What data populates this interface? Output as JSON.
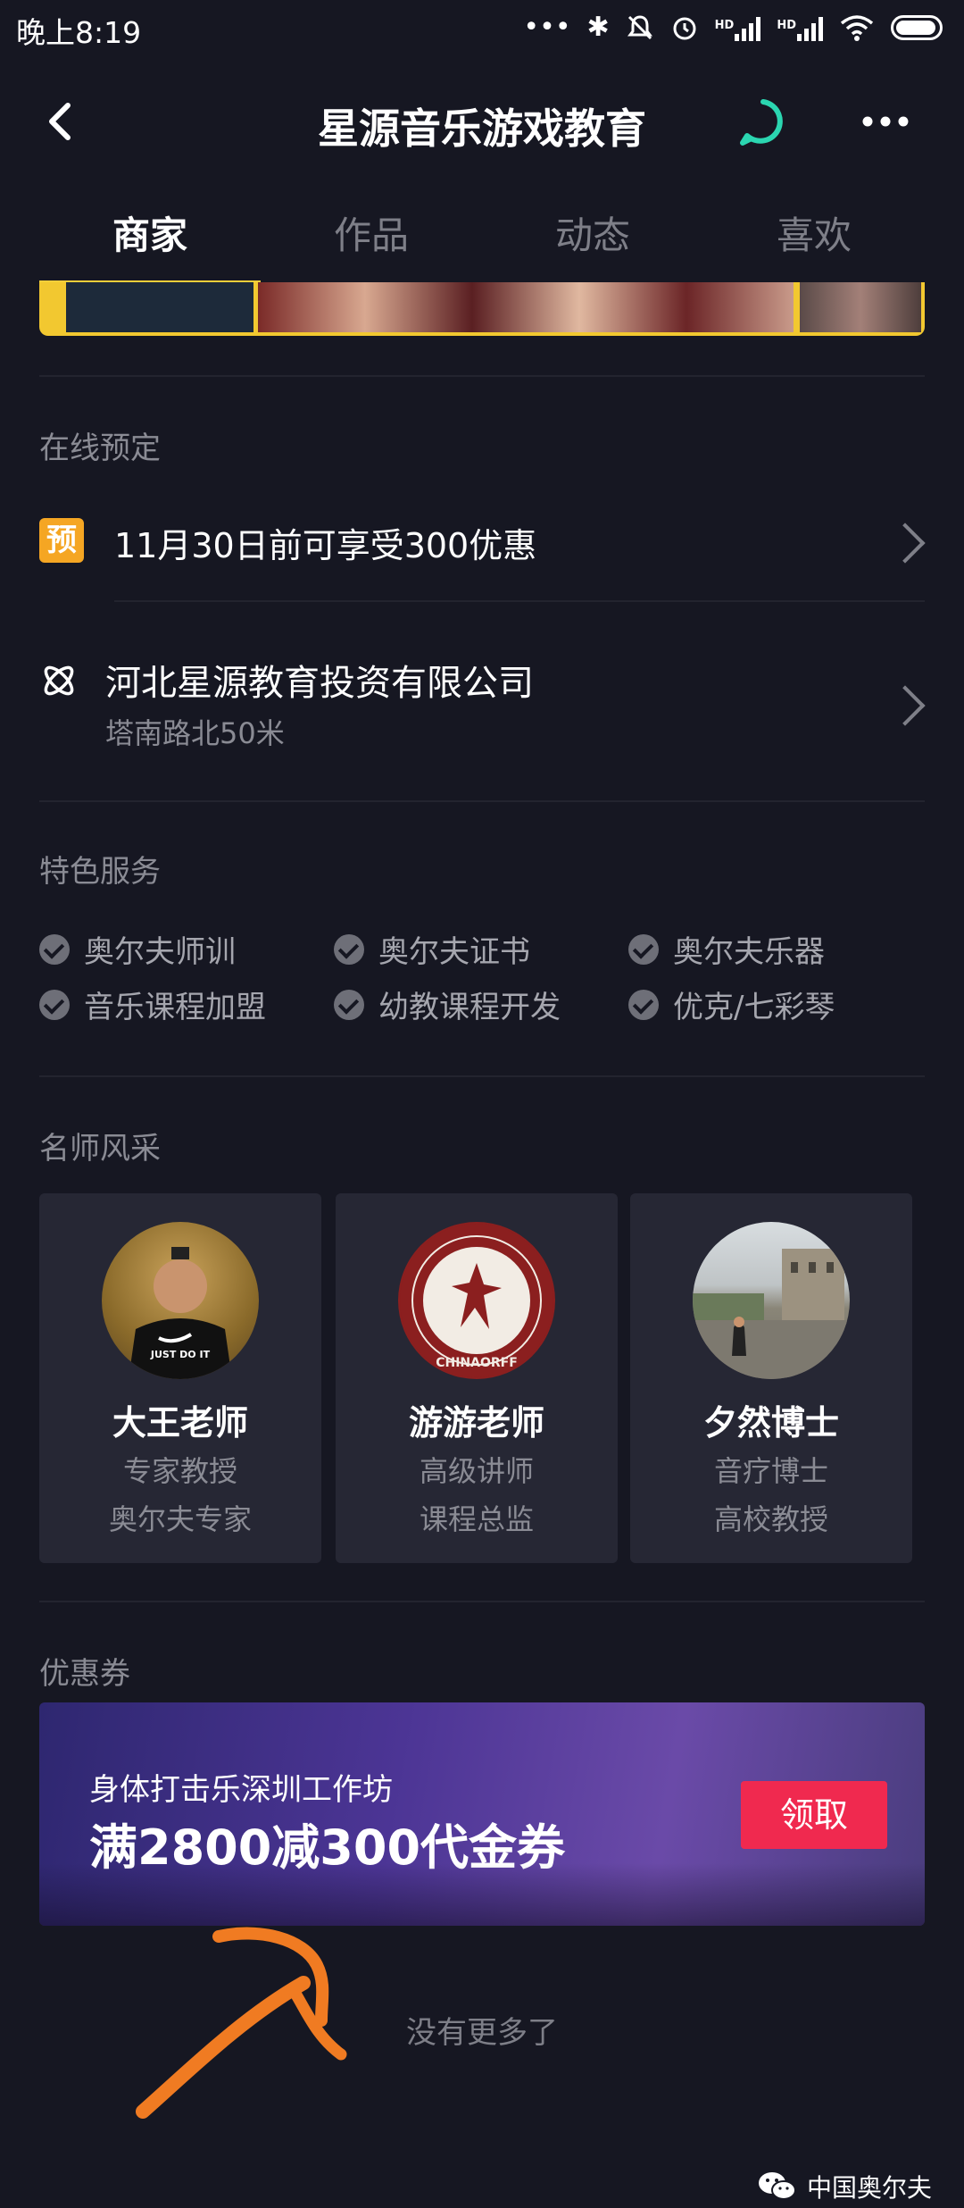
{
  "status_bar": {
    "time": "晚上8:19",
    "icons": [
      "more-dots-icon",
      "bluetooth-icon",
      "mute-icon",
      "alarm-icon",
      "signal-hd-icon",
      "signal-hd-icon",
      "wifi-icon",
      "battery-icon"
    ]
  },
  "nav": {
    "title": "星源音乐游戏教育",
    "accent": "#2bd6b1"
  },
  "tabs": [
    {
      "label": "商家",
      "active": true
    },
    {
      "label": "作品",
      "active": false
    },
    {
      "label": "动态",
      "active": false
    },
    {
      "label": "喜欢",
      "active": false
    }
  ],
  "booking": {
    "section_title": "在线预定",
    "badge": "预",
    "offer": "11月30日前可享受300优惠"
  },
  "company": {
    "name": "河北星源教育投资有限公司",
    "address": "塔南路北50米"
  },
  "features": {
    "section_title": "特色服务",
    "items": [
      "奥尔夫师训",
      "奥尔夫证书",
      "奥尔夫乐器",
      "音乐课程加盟",
      "幼教课程开发",
      "优克/七彩琴"
    ]
  },
  "teachers": {
    "section_title": "名师风采",
    "items": [
      {
        "name": "大王老师",
        "role1": "专家教授",
        "role2": "奥尔夫专家",
        "avatar_text": "JUST DO IT"
      },
      {
        "name": "游游老师",
        "role1": "高级讲师",
        "role2": "课程总监",
        "avatar_text": "CHINAORFF"
      },
      {
        "name": "夕然博士",
        "role1": "音疗博士",
        "role2": "高校教授"
      }
    ]
  },
  "coupon": {
    "section_title": "优惠券",
    "subtitle": "身体打击乐深圳工作坊",
    "title": "满2800减300代金券",
    "button": "领取",
    "button_color": "#f0294f"
  },
  "footer": {
    "no_more": "没有更多了",
    "watermark": "中国奥尔夫"
  }
}
